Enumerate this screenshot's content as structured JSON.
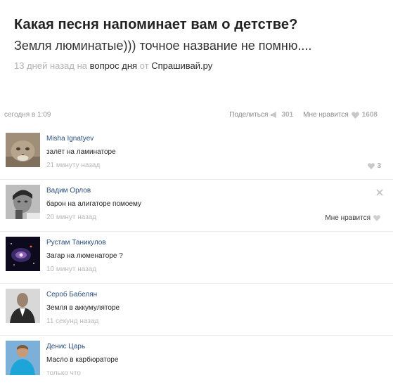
{
  "question": {
    "title": "Какая песня напоминает вам о детстве?",
    "answer": "Земля люминатые))) точное название не помню....",
    "meta": {
      "time_ago": "13 дней назад",
      "on_word": "на",
      "category": "вопрос дня",
      "from_word": "от",
      "source": "Спрашивай.ру"
    }
  },
  "post_bar": {
    "posted": "сегодня в 1:09",
    "share_label": "Поделиться",
    "share_count": "301",
    "like_label": "Мне нравится",
    "like_count": "1608"
  },
  "comments": [
    {
      "author": "Misha Ignatyev",
      "text": "залёт на ламинаторе",
      "time": "21 минуту назад",
      "likes": "3"
    },
    {
      "author": "Вадим Орлов",
      "text": "барон на алигаторе помоему",
      "time": "20 минут назад",
      "like_button": "Мне нравится"
    },
    {
      "author": "Рустам Таникулов",
      "text": "Загар на люменаторе ?",
      "time": "10 минут назад"
    },
    {
      "author": "Сероб Бабелян",
      "text": "Земля в аккумуляторе",
      "time": "11 секунд назад"
    },
    {
      "author": "Денис Царь",
      "text": "Масло в карбюраторе",
      "time": "только что"
    }
  ],
  "colors": {
    "link": "#2c4f7c",
    "muted": "#b3b3b3",
    "heart": "#c8c8c8"
  }
}
